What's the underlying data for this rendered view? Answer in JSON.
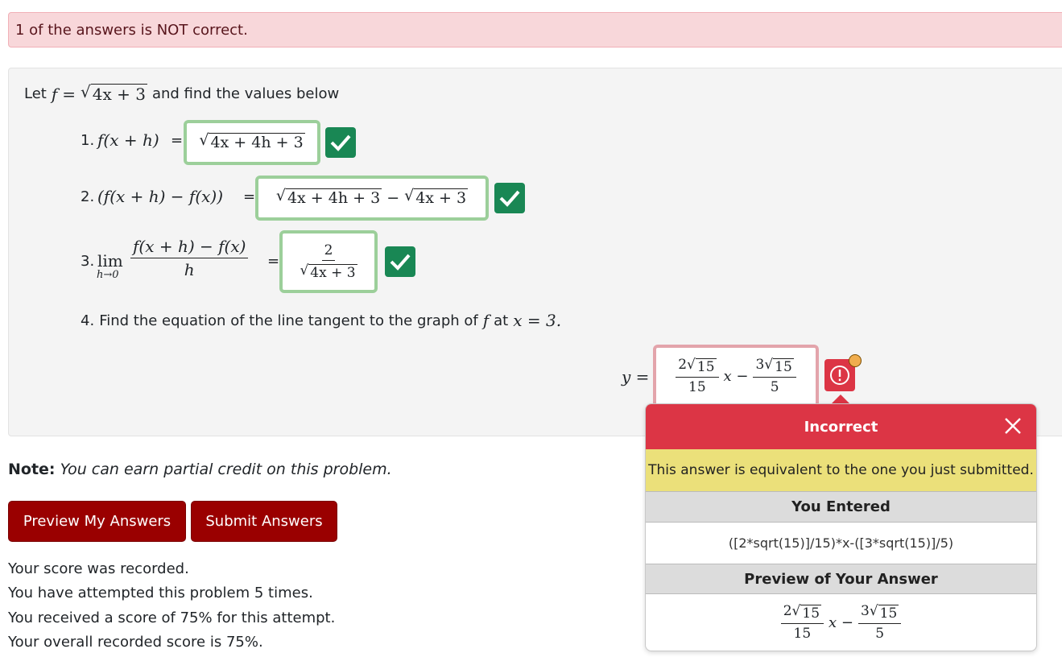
{
  "alert": {
    "text": "1 of the answers is NOT correct."
  },
  "problem": {
    "intro_prefix": "Let",
    "intro_suffix": "and find the values below",
    "f_radicand": "4x + 3",
    "parts": [
      {
        "number": "1.",
        "answer_radicand": "4x + 4h + 3",
        "status": "correct"
      },
      {
        "number": "2.",
        "answer_radicand_1": "4x + 4h + 3",
        "answer_radicand_2": "4x + 3",
        "status": "correct"
      },
      {
        "number": "3.",
        "lim_label": "lim",
        "lim_sub": "h→0",
        "numerator": "f(x + h) − f(x)",
        "denominator": "h",
        "answer_num": "2",
        "answer_radicand": "4x + 3",
        "status": "correct"
      },
      {
        "number": "4.",
        "text_prefix": "Find the equation of the line tangent to the graph of",
        "text_mid": "at",
        "text_value": "x = 3.",
        "status": "incorrect"
      }
    ],
    "part4_answer": {
      "lhs": "y =",
      "coef1": "2",
      "rad1": "15",
      "den1": "15",
      "coef2": "3",
      "rad2": "15",
      "den2": "5"
    }
  },
  "note": {
    "label": "Note:",
    "text": "You can earn partial credit on this problem."
  },
  "buttons": {
    "preview": "Preview My Answers",
    "submit": "Submit Answers"
  },
  "score": {
    "line1": "Your score was recorded.",
    "line2": "You have attempted this problem 5 times.",
    "line3": "You received a score of 75% for this attempt.",
    "line4": "Your overall recorded score is 75%."
  },
  "popover": {
    "title": "Incorrect",
    "message": "This answer is equivalent to the one you just submitted.",
    "entered_label": "You Entered",
    "entered_value": "([2*sqrt(15)]/15)*x-([3*sqrt(15)]/5)",
    "preview_label": "Preview of Your Answer"
  },
  "colors": {
    "correct": "#198754",
    "incorrect": "#dc3545",
    "button": "#9a0000",
    "alert_bg": "#f8d7da",
    "warning_dot": "#f0ad4e"
  }
}
